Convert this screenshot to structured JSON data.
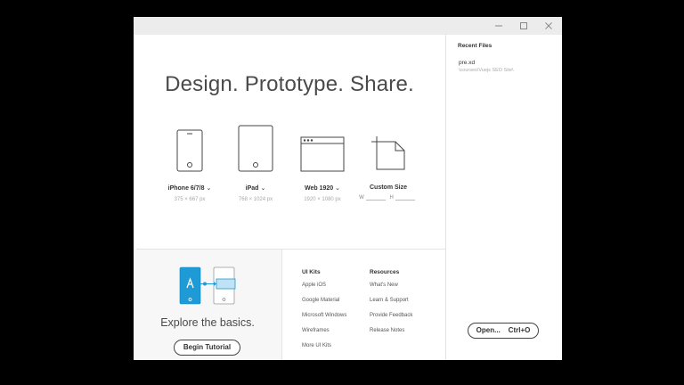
{
  "headline": "Design. Prototype. Share.",
  "presets": [
    {
      "name": "iPhone 6/7/8",
      "dims": "375 × 667 px"
    },
    {
      "name": "iPad",
      "dims": "768 × 1024 px"
    },
    {
      "name": "Web 1920",
      "dims": "1920 × 1080 px"
    },
    {
      "name": "Custom Size",
      "w_label": "W",
      "h_label": "H"
    }
  ],
  "chevron": "⌄",
  "tutorial": {
    "explore": "Explore the basics.",
    "begin_label": "Begin Tutorial",
    "accent": "#1e9ad6"
  },
  "ui_kits": {
    "heading": "UI Kits",
    "items": [
      "Apple iOS",
      "Google Material",
      "Microsoft Windows",
      "Wireframes",
      "More UI Kits"
    ]
  },
  "resources": {
    "heading": "Resources",
    "items": [
      "What's New",
      "Learn & Support",
      "Provide Feedback",
      "Release Notes"
    ]
  },
  "recent": {
    "heading": "Recent Files",
    "files": [
      {
        "name": "pre.xd",
        "path": "\\courses\\Vuejs SEO Site\\"
      }
    ]
  },
  "open_label": "Open...    Ctrl+O"
}
